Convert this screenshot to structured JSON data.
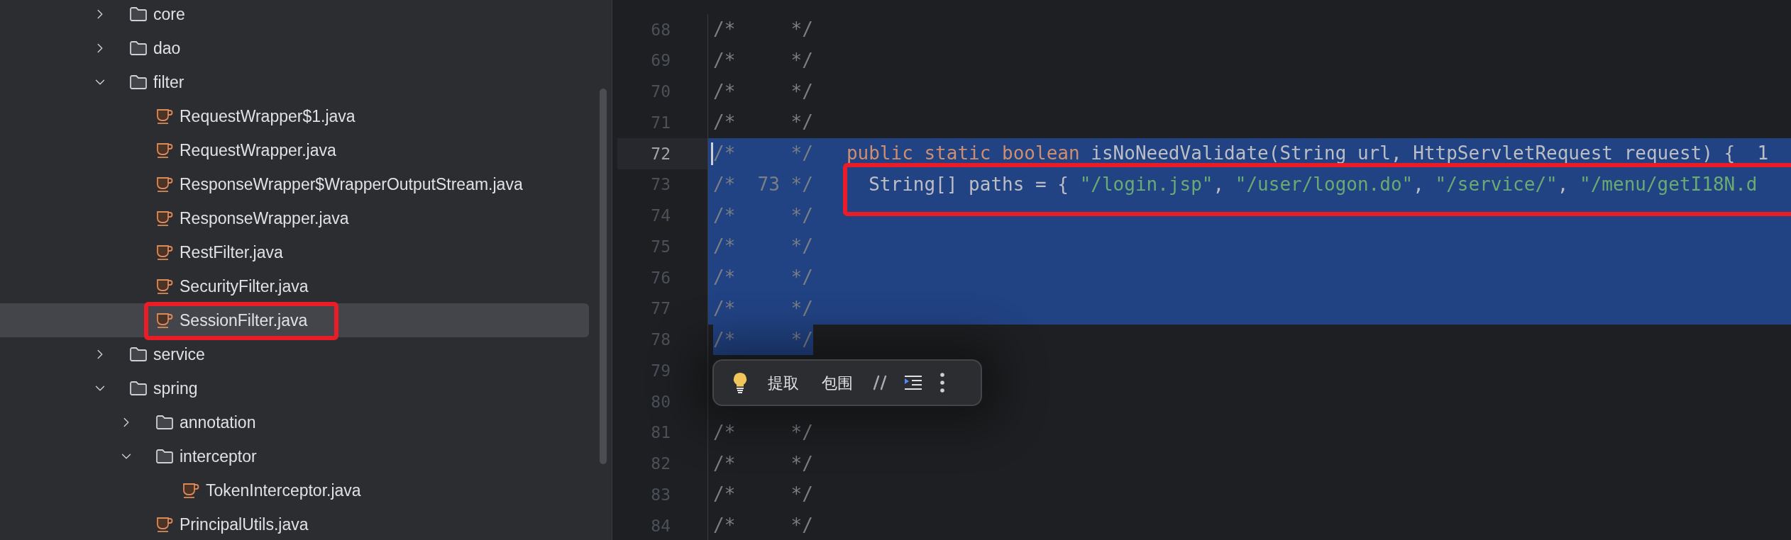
{
  "project_tree": [
    {
      "kind": "folder",
      "label": "core",
      "expanded": false,
      "selected": false,
      "annotated": false
    },
    {
      "kind": "folder",
      "label": "dao",
      "expanded": false,
      "selected": false,
      "annotated": false
    },
    {
      "kind": "folder",
      "label": "filter",
      "expanded": true,
      "selected": false,
      "annotated": false,
      "children": [
        {
          "kind": "file",
          "label": "RequestWrapper$1.java",
          "selected": false,
          "annotated": false
        },
        {
          "kind": "file",
          "label": "RequestWrapper.java",
          "selected": false,
          "annotated": false
        },
        {
          "kind": "file",
          "label": "ResponseWrapper$WrapperOutputStream.java",
          "selected": false,
          "annotated": false
        },
        {
          "kind": "file",
          "label": "ResponseWrapper.java",
          "selected": false,
          "annotated": false
        },
        {
          "kind": "file",
          "label": "RestFilter.java",
          "selected": false,
          "annotated": false
        },
        {
          "kind": "file",
          "label": "SecurityFilter.java",
          "selected": false,
          "annotated": false
        },
        {
          "kind": "file",
          "label": "SessionFilter.java",
          "selected": true,
          "annotated": true
        }
      ]
    },
    {
      "kind": "folder",
      "label": "service",
      "expanded": false,
      "selected": false,
      "annotated": false
    },
    {
      "kind": "folder",
      "label": "spring",
      "expanded": true,
      "selected": false,
      "annotated": false,
      "children": [
        {
          "kind": "folder",
          "label": "annotation",
          "expanded": false,
          "selected": false,
          "annotated": false
        },
        {
          "kind": "folder",
          "label": "interceptor",
          "expanded": true,
          "selected": false,
          "annotated": false,
          "children": [
            {
              "kind": "file",
              "label": "TokenInterceptor.java",
              "selected": false,
              "annotated": false
            }
          ]
        },
        {
          "kind": "file",
          "label": "PrincipalUtils.java",
          "selected": false,
          "annotated": false
        }
      ]
    }
  ],
  "editor": {
    "lines": [
      {
        "number": "68",
        "prefix": "/*     */",
        "selected": false,
        "selected_to_end": false,
        "current": false,
        "annotated": false
      },
      {
        "number": "69",
        "prefix": "/*     */",
        "selected": false,
        "selected_to_end": false,
        "current": false,
        "annotated": false
      },
      {
        "number": "70",
        "prefix": "/*     */",
        "selected": false,
        "selected_to_end": false,
        "current": false,
        "annotated": false
      },
      {
        "number": "71",
        "prefix": "/*     */",
        "selected": false,
        "selected_to_end": false,
        "current": false,
        "annotated": false
      },
      {
        "number": "72",
        "prefix": "/*     */",
        "selected": true,
        "selected_to_end": true,
        "current": true,
        "annotated": false,
        "tokens": [
          {
            "kind": "keyword",
            "text": "public static boolean"
          },
          {
            "kind": "plain",
            "text": " isNoNeedValidate(String url, HttpServletRequest request) {  1"
          }
        ]
      },
      {
        "number": "73",
        "prefix": "/*  73 */",
        "selected": true,
        "selected_to_end": true,
        "current": false,
        "annotated": true,
        "tokens": [
          {
            "kind": "plain",
            "text": "  String[] paths = { "
          },
          {
            "kind": "string",
            "text": "\"/login.jsp\""
          },
          {
            "kind": "plain",
            "text": ", "
          },
          {
            "kind": "string",
            "text": "\"/user/logon.do\""
          },
          {
            "kind": "plain",
            "text": ", "
          },
          {
            "kind": "string",
            "text": "\"/service/\""
          },
          {
            "kind": "plain",
            "text": ", "
          },
          {
            "kind": "string",
            "text": "\"/menu/getI18N.d"
          }
        ]
      },
      {
        "number": "74",
        "prefix": "/*     */",
        "selected": true,
        "selected_to_end": true,
        "current": false,
        "annotated": false
      },
      {
        "number": "75",
        "prefix": "/*     */",
        "selected": true,
        "selected_to_end": true,
        "current": false,
        "annotated": false
      },
      {
        "number": "76",
        "prefix": "/*     */",
        "selected": true,
        "selected_to_end": true,
        "current": false,
        "annotated": false
      },
      {
        "number": "77",
        "prefix": "/*     */",
        "selected": true,
        "selected_to_end": true,
        "current": false,
        "annotated": false
      },
      {
        "number": "78",
        "prefix": "/*     */",
        "selected": true,
        "selected_to_end": false,
        "current": false,
        "annotated": false
      },
      {
        "number": "79",
        "selected": false,
        "selected_to_end": false,
        "current": false,
        "annotated": false
      },
      {
        "number": "80",
        "selected": false,
        "selected_to_end": false,
        "current": false,
        "annotated": false
      },
      {
        "number": "81",
        "prefix": "/*     */",
        "selected": false,
        "selected_to_end": false,
        "current": false,
        "annotated": false
      },
      {
        "number": "82",
        "prefix": "/*     */",
        "selected": false,
        "selected_to_end": false,
        "current": false,
        "annotated": false
      },
      {
        "number": "83",
        "prefix": "/*     */",
        "selected": false,
        "selected_to_end": false,
        "current": false,
        "annotated": false
      },
      {
        "number": "84",
        "prefix": "/*     */",
        "selected": false,
        "selected_to_end": false,
        "current": false,
        "annotated": false
      }
    ],
    "popup": {
      "actions": [
        {
          "kind": "bulb"
        },
        {
          "kind": "text",
          "label": "提取"
        },
        {
          "kind": "text",
          "label": "包围"
        },
        {
          "kind": "comment"
        },
        {
          "kind": "indent"
        },
        {
          "kind": "more"
        }
      ]
    }
  }
}
